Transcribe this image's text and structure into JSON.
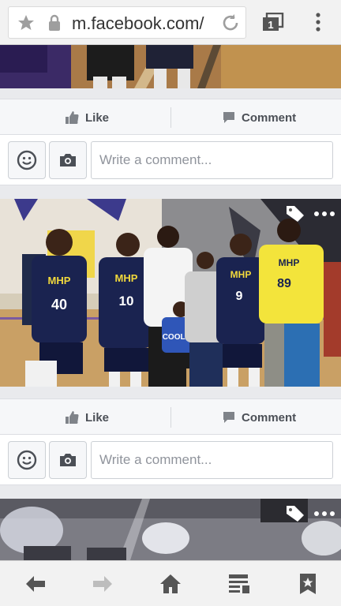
{
  "browser": {
    "url": "m.facebook.com/",
    "tab_count": "1"
  },
  "posts": [
    {
      "like_label": "Like",
      "comment_label": "Comment",
      "comment_placeholder": "Write a comment..."
    },
    {
      "like_label": "Like",
      "comment_label": "Comment",
      "comment_placeholder": "Write a comment..."
    }
  ],
  "photo_main": {
    "jerseys": [
      "MHP 40",
      "MHP 10",
      "COOL 24",
      "MHP 9",
      "MHP 89"
    ]
  },
  "colors": {
    "accent": "#4b4f56",
    "page_bg": "#e9eaed"
  }
}
